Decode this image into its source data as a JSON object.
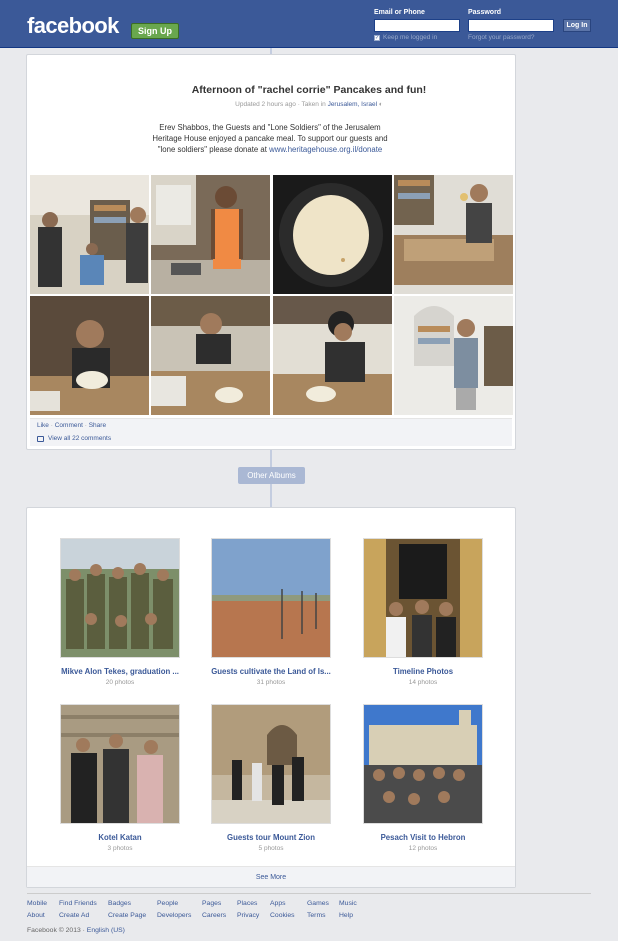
{
  "header": {
    "logo": "facebook",
    "signup_label": "Sign Up",
    "email_label": "Email or Phone",
    "password_label": "Password",
    "login_label": "Log In",
    "keep_logged_in": "Keep me logged in",
    "forgot_password": "Forgot your password?"
  },
  "album": {
    "title": "Afternoon of \"rachel corrie\" Pancakes and fun!",
    "meta_prefix": "Updated 2 hours ago · Taken in ",
    "location": "Jerusalem, Israel",
    "description": "Erev Shabbos, the Guests and \"Lone Soldiers\" of the Jerusalem Heritage House enjoyed a pancake meal. To support our guests and \"lone soldiers\" please donate at ",
    "donate_link": "www.heritagehouse.org.il/donate",
    "like": "Like",
    "comment": "Comment",
    "share": "Share",
    "view_comments": "View all 22 comments"
  },
  "other_albums_label": "Other Albums",
  "albums": [
    {
      "name": "Mikve Alon Tekes, graduation ...",
      "count": "20 photos"
    },
    {
      "name": "Guests cultivate the Land of Is...",
      "count": "31 photos"
    },
    {
      "name": "Timeline Photos",
      "count": "14 photos"
    },
    {
      "name": "Kotel Katan",
      "count": "3 photos"
    },
    {
      "name": "Guests tour Mount Zion",
      "count": "5 photos"
    },
    {
      "name": "Pesach Visit to Hebron",
      "count": "12 photos"
    }
  ],
  "see_more": "See More",
  "footer": {
    "row1": [
      "Mobile",
      "Find Friends",
      "Badges",
      "People",
      "Pages",
      "Places",
      "Apps",
      "Games",
      "Music"
    ],
    "row2": [
      "About",
      "Create Ad",
      "Create Page",
      "Developers",
      "Careers",
      "Privacy",
      "Cookies",
      "Terms",
      "Help"
    ],
    "copyright": "Facebook © 2013 · ",
    "language": "English (US)"
  },
  "colors": {
    "brand": "#3b5998",
    "signup": "#69a74e",
    "background": "#e9eaed"
  }
}
